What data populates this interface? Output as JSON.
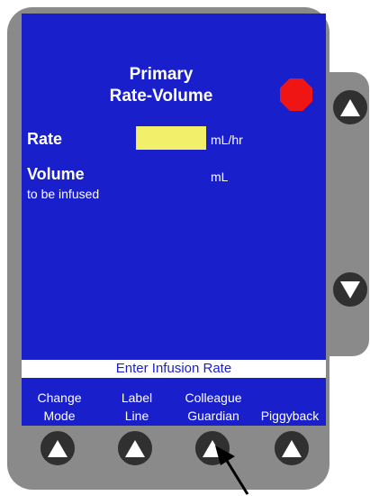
{
  "screen": {
    "title_line1": "Primary",
    "title_line2": "Rate-Volume",
    "rate_label": "Rate",
    "rate_value": "",
    "rate_unit": "mL/hr",
    "volume_label": "Volume",
    "volume_sublabel": "to be infused",
    "volume_unit": "mL",
    "prompt": "Enter Infusion Rate"
  },
  "softkeys": [
    {
      "line1": "Change",
      "line2": "Mode"
    },
    {
      "line1": "Label",
      "line2": "Line"
    },
    {
      "line1": "Colleague",
      "line2": "Guardian"
    },
    {
      "line1": "",
      "line2": "Piggyback"
    }
  ],
  "icons": {
    "stop": "stop-icon",
    "scroll_up": "triangle-up-icon",
    "scroll_down": "triangle-down-icon",
    "pointer": "arrow-pointer-icon"
  },
  "colors": {
    "screen_bg": "#1a1fcc",
    "rate_highlight": "#f2ef6a",
    "stop": "#f01515",
    "device_body": "#8a8a8a"
  }
}
